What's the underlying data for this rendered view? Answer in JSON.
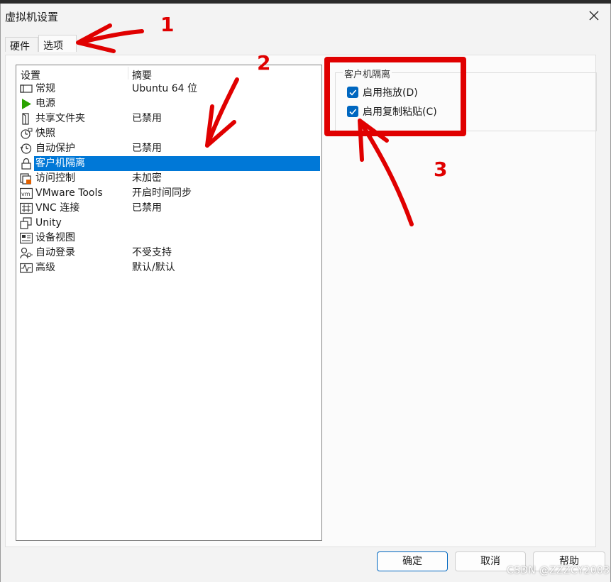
{
  "window": {
    "title": "虚拟机设置"
  },
  "tabs": [
    {
      "label": "硬件"
    },
    {
      "label": "选项"
    }
  ],
  "list": {
    "header_setting": "设置",
    "header_summary": "摘要",
    "items": [
      {
        "label": "常规",
        "summary": "Ubuntu 64 位",
        "icon": "general-icon"
      },
      {
        "label": "电源",
        "summary": "",
        "icon": "power-play-icon"
      },
      {
        "label": "共享文件夹",
        "summary": "已禁用",
        "icon": "shared-folder-icon"
      },
      {
        "label": "快照",
        "summary": "",
        "icon": "snapshot-icon"
      },
      {
        "label": "自动保护",
        "summary": "已禁用",
        "icon": "autoprotect-clock-icon"
      },
      {
        "label": "客户机隔离",
        "summary": "",
        "icon": "lock-icon"
      },
      {
        "label": "访问控制",
        "summary": "未加密",
        "icon": "access-control-icon"
      },
      {
        "label": "VMware Tools",
        "summary": "开启时间同步",
        "icon": "vm-icon"
      },
      {
        "label": "VNC 连接",
        "summary": "已禁用",
        "icon": "vnc-icon"
      },
      {
        "label": "Unity",
        "summary": "",
        "icon": "unity-icon"
      },
      {
        "label": "设备视图",
        "summary": "",
        "icon": "device-view-icon"
      },
      {
        "label": "自动登录",
        "summary": "不受支持",
        "icon": "auto-login-icon"
      },
      {
        "label": "高级",
        "summary": "默认/默认",
        "icon": "advanced-pulse-icon"
      }
    ],
    "selected_index": 5
  },
  "isolation": {
    "group_title": "客户机隔离",
    "enable_drag_drop": {
      "label": "启用拖放(D)",
      "checked": true
    },
    "enable_copy_paste": {
      "label": "启用复制粘贴(C)",
      "checked": true
    }
  },
  "buttons": {
    "ok": "确定",
    "cancel": "取消",
    "help": "帮助"
  },
  "annotations": {
    "n1": "1",
    "n2": "2",
    "n3": "3",
    "color": "#e00000"
  },
  "watermark": "CSDN @ZZZCY2003",
  "colors": {
    "selection": "#0078d7",
    "checkbox": "#0067c0",
    "power_green": "#2aa300",
    "lock_orange": "#e06000"
  }
}
